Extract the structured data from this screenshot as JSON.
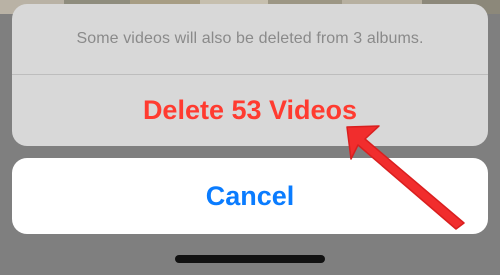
{
  "sheet": {
    "message": "Some videos will also be deleted from 3 albums.",
    "delete_label": "Delete 53 Videos",
    "cancel_label": "Cancel"
  },
  "colors": {
    "backdrop": "#7f7f7f",
    "sheet_background": "#d8d8d8",
    "message_text": "#8a8a8a",
    "destructive": "#ff3b30",
    "cancel_text": "#0a7cff",
    "annotation_arrow": "#f12d2d",
    "home_indicator": "#111111"
  },
  "icons": {
    "annotation": "red-arrow-icon"
  }
}
